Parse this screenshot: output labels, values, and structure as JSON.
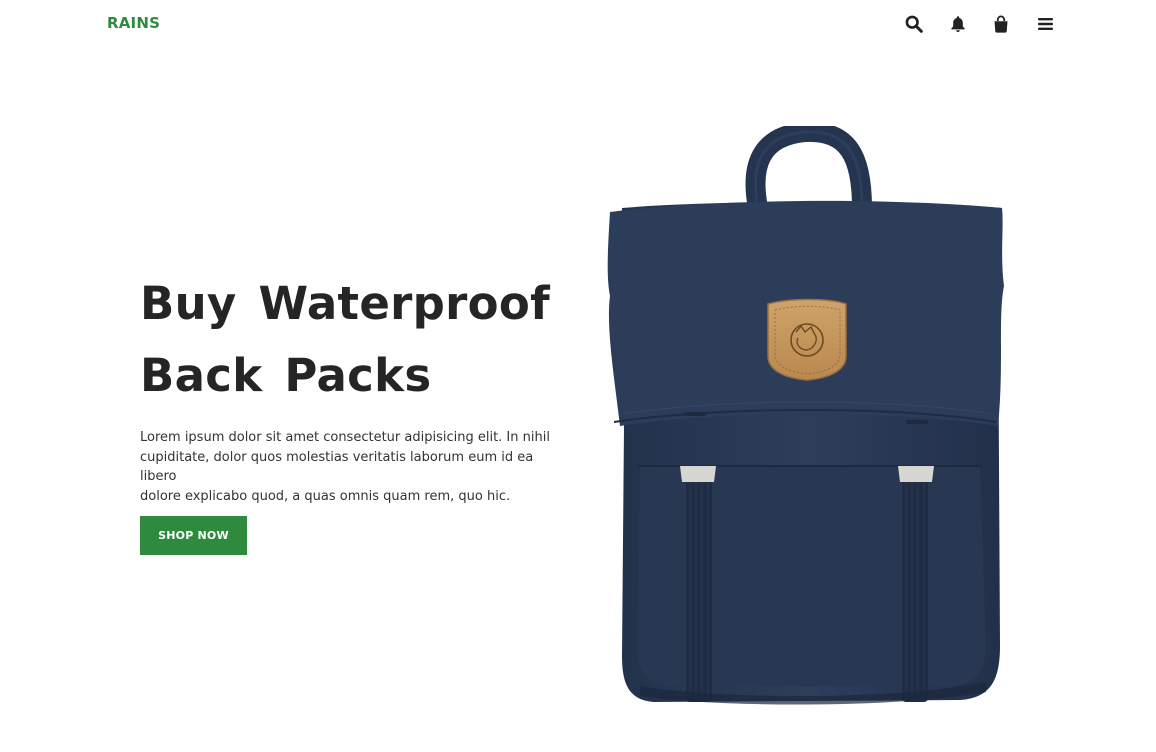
{
  "brand": {
    "name": "RAINS",
    "color": "#2e8b3e"
  },
  "nav": {
    "icons": [
      "search-icon",
      "bell-icon",
      "shopping-bag-icon",
      "menu-icon"
    ]
  },
  "hero": {
    "title_line1": "Buy Waterproof",
    "title_line2": "Back Packs",
    "text_line1": "Lorem ipsum dolor sit amet consectetur adipisicing elit. In nihil",
    "text_line2": "cupiditate, dolor quos molestias veritatis laborum eum id ea libero",
    "text_line3": "dolore explicabo quod, a quas omnis quam rem, quo hic.",
    "cta_label": "SHOP NOW"
  },
  "colors": {
    "accent": "#2e8b3e",
    "backpack": "#2a3a55",
    "patch": "#c79a5e"
  }
}
